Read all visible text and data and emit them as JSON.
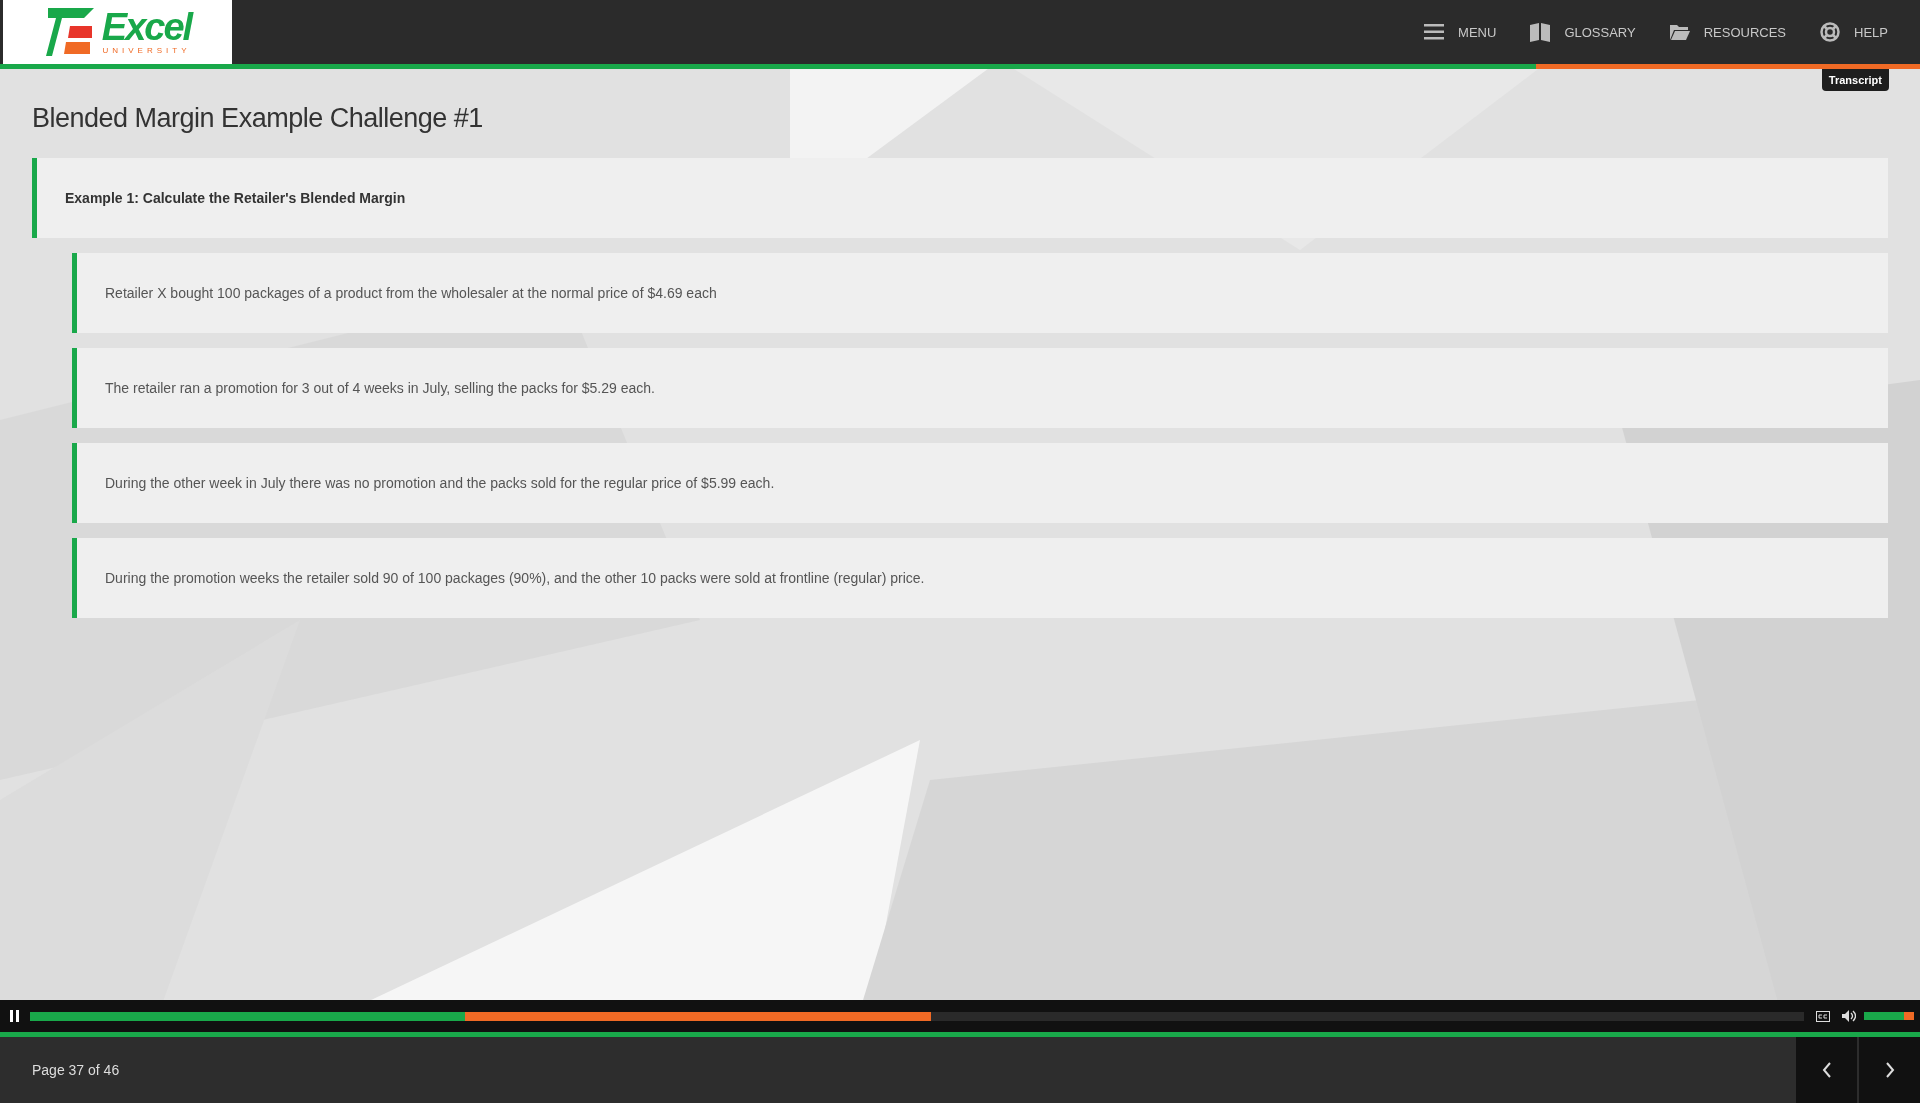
{
  "header": {
    "logo": {
      "name": "Excel",
      "tagline": "UNIVERSITY"
    },
    "nav": [
      {
        "kind": "menu",
        "label": "MENU"
      },
      {
        "kind": "book",
        "label": "GLOSSARY"
      },
      {
        "kind": "folder",
        "label": "RESOURCES"
      },
      {
        "kind": "help",
        "label": "HELP"
      }
    ],
    "progress": {
      "level": 0.8
    },
    "tooltip": "Transcript"
  },
  "slide": {
    "title": "Blended Margin Example Challenge #1",
    "heading": "Example 1: Calculate the Retailer's Blended Margin",
    "points": [
      "Retailer X bought 100 packages of a product from the wholesaler at the normal price of $4.69 each",
      "The retailer ran a promotion for 3 out of 4 weeks in July, selling the packs for $5.29 each.",
      "During the other week in July there was no promotion and the packs sold for the regular price of $5.99 each.",
      "During the promotion weeks the retailer sold 90 of 100 packages (90%), and the other 10 packs were sold at frontline (regular) price."
    ]
  },
  "player": {
    "playing": true,
    "played": {
      "level": 0.245
    },
    "buffered": {
      "level": 0.508
    },
    "volume": {
      "level": 0.8
    }
  },
  "footer": {
    "page": "Page 37 of 46"
  }
}
